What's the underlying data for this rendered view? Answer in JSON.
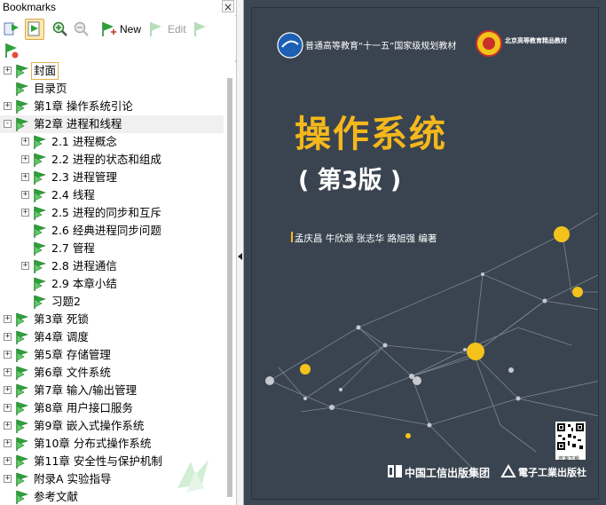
{
  "panel": {
    "title": "Bookmarks",
    "close_glyph": "×"
  },
  "toolbar": {
    "buttons": [
      {
        "name": "expand-all",
        "label": "",
        "icon": "bookmark-options-icon"
      },
      {
        "name": "new-from-structure",
        "label": "",
        "icon": "bookmark-page-icon",
        "pressed": true
      },
      {
        "name": "zoom-in",
        "label": "",
        "icon": "zoom-in-icon"
      },
      {
        "name": "zoom-out",
        "label": "",
        "icon": "zoom-out-icon",
        "disabled": true
      },
      {
        "name": "new",
        "label": "New",
        "icon": "bookmark-new-icon"
      },
      {
        "name": "edit",
        "label": "Edit",
        "icon": "bookmark-edit-icon",
        "disabled": true
      },
      {
        "name": "delete",
        "label": "",
        "icon": "bookmark-delete-icon",
        "disabled": true
      },
      {
        "name": "properties",
        "label": "",
        "icon": "bookmark-properties-icon"
      }
    ]
  },
  "bookmarks": [
    {
      "label": "封面",
      "level": 0,
      "expander": "+",
      "selected": true
    },
    {
      "label": "目录页",
      "level": 0,
      "expander": ""
    },
    {
      "label": "第1章  操作系统引论",
      "level": 0,
      "expander": "+"
    },
    {
      "label": "第2章  进程和线程",
      "level": 0,
      "expander": "-",
      "highlight": true
    },
    {
      "label": "2.1  进程概念",
      "level": 1,
      "expander": "+"
    },
    {
      "label": "2.2  进程的状态和组成",
      "level": 1,
      "expander": "+"
    },
    {
      "label": "2.3  进程管理",
      "level": 1,
      "expander": "+"
    },
    {
      "label": "2.4  线程",
      "level": 1,
      "expander": "+"
    },
    {
      "label": "2.5  进程的同步和互斥",
      "level": 1,
      "expander": "+"
    },
    {
      "label": "2.6  经典进程同步问题",
      "level": 1,
      "expander": ""
    },
    {
      "label": "2.7  管程",
      "level": 1,
      "expander": ""
    },
    {
      "label": "2.8  进程通信",
      "level": 1,
      "expander": "+"
    },
    {
      "label": "2.9  本章小结",
      "level": 1,
      "expander": ""
    },
    {
      "label": "习题2",
      "level": 1,
      "expander": ""
    },
    {
      "label": "第3章  死锁",
      "level": 0,
      "expander": "+"
    },
    {
      "label": "第4章  调度",
      "level": 0,
      "expander": "+"
    },
    {
      "label": "第5章  存储管理",
      "level": 0,
      "expander": "+"
    },
    {
      "label": "第6章  文件系统",
      "level": 0,
      "expander": "+"
    },
    {
      "label": "第7章  输入/输出管理",
      "level": 0,
      "expander": "+"
    },
    {
      "label": "第8章  用户接口服务",
      "level": 0,
      "expander": "+"
    },
    {
      "label": "第9章  嵌入式操作系统",
      "level": 0,
      "expander": "+"
    },
    {
      "label": "第10章  分布式操作系统",
      "level": 0,
      "expander": "+"
    },
    {
      "label": "第11章  安全性与保护机制",
      "level": 0,
      "expander": "+"
    },
    {
      "label": "附录A  实验指导",
      "level": 0,
      "expander": "+"
    },
    {
      "label": "参考文献",
      "level": 0,
      "expander": ""
    }
  ],
  "cover": {
    "series": "普通高等教育“十一五”国家级规划教材",
    "series_right": "北京高等教育精品教材",
    "title": "操作系统",
    "edition": "( 第3版 )",
    "authors": "孟庆昌   牛欣源   张志华   路旭强   编著",
    "publisher_left": "中国工信出版集团",
    "publisher_right": "電子工業出版社",
    "qr_label": "资源下载",
    "colors": {
      "background": "#3a4450",
      "title": "#f4b81c",
      "accent_dots": "#f4c21c",
      "network_lines": "#8e97a2"
    }
  },
  "colors": {
    "bookmark_icon_green": "#2ea23a",
    "selection_border": "#e0b453",
    "highlight_row": "#f0f0f0"
  }
}
